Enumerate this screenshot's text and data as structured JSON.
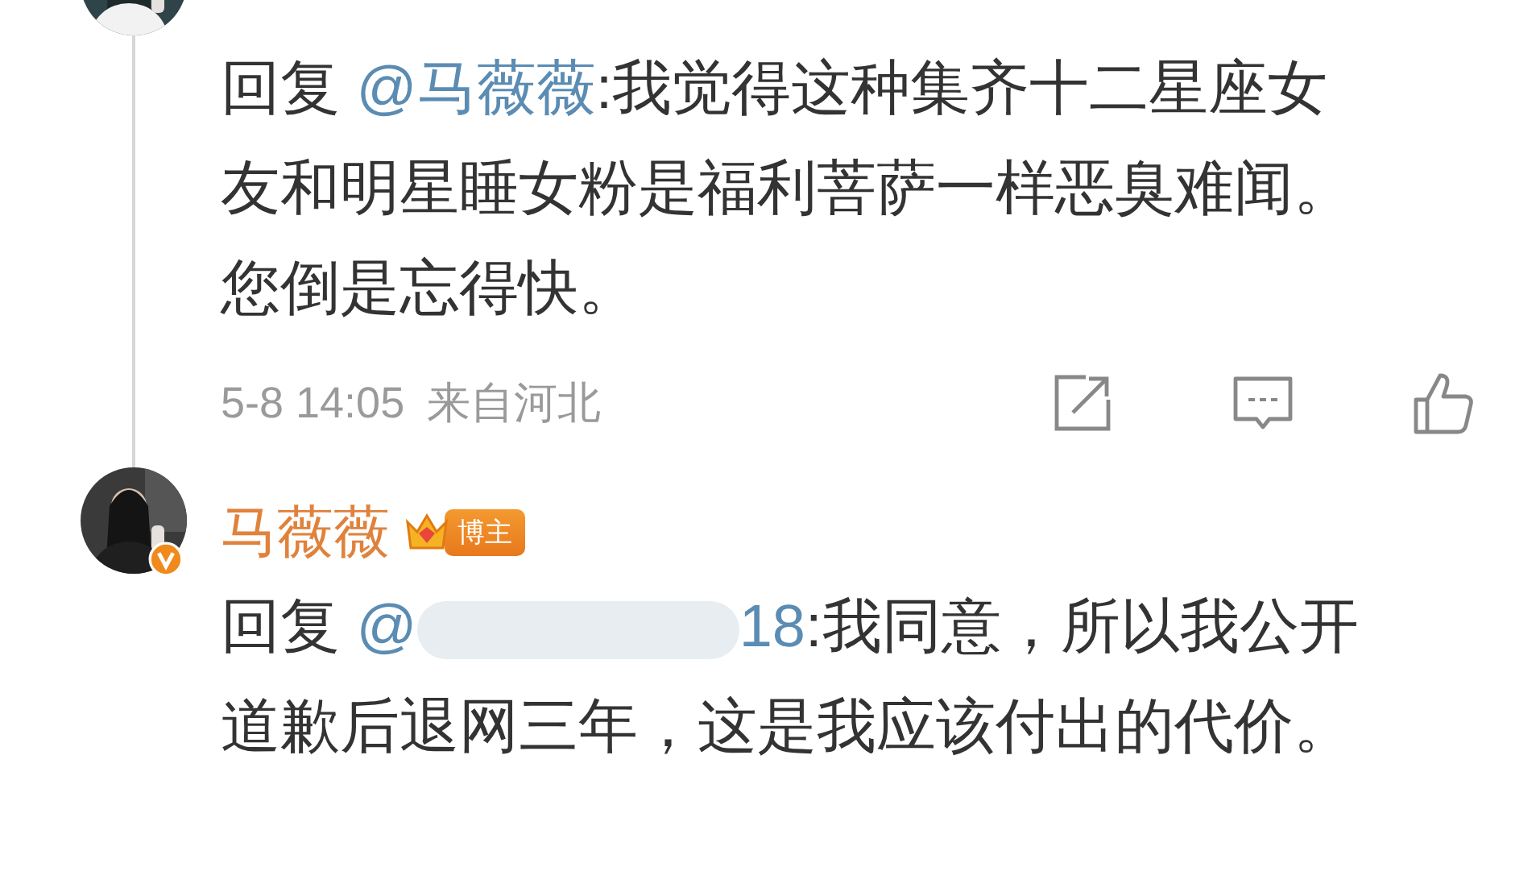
{
  "comments": [
    {
      "reply_prefix": "回复",
      "mention": "@马薇薇",
      "text": ":我觉得这种集齐十二星座女友和明星睡女粉是福利菩萨一样恶臭难闻。您倒是忘得快。",
      "time": "5-8 14:05",
      "location": "来自河北",
      "actions": [
        {
          "kind": "share"
        },
        {
          "kind": "comment"
        },
        {
          "kind": "like"
        }
      ]
    },
    {
      "author": "马薇薇",
      "verified": true,
      "badge": "博主",
      "reply_prefix": "回复",
      "mention": "@",
      "redacted": true,
      "mention_tail": "18",
      "text": ":我同意，所以我公开道歉后退网三年，这是我应该付出的代价。"
    }
  ]
}
